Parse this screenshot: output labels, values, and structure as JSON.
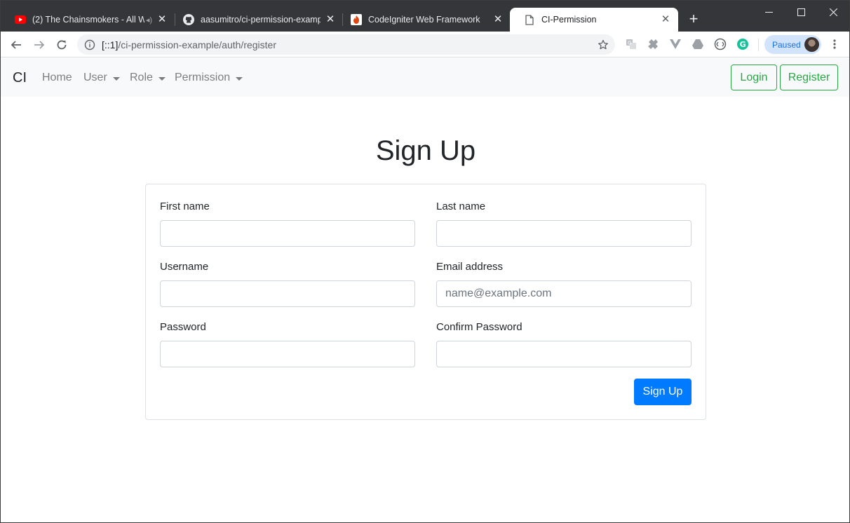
{
  "browser": {
    "tabs": [
      {
        "title": "(2) The Chainsmokers - All W",
        "icon": "youtube-icon",
        "active": false
      },
      {
        "title": "aasumitro/ci-permission-example",
        "icon": "github-icon",
        "active": false
      },
      {
        "title": "CodeIgniter Web Framework",
        "icon": "codeigniter-icon",
        "active": false
      },
      {
        "title": "CI-Permission",
        "icon": "page-icon",
        "active": true
      }
    ],
    "url_host": "[::1]",
    "url_path": "/ci-permission-example/auth/register",
    "profile_status": "Paused"
  },
  "navbar": {
    "brand": "CI",
    "links": {
      "home": "Home",
      "user": "User",
      "role": "Role",
      "permission": "Permission"
    },
    "login_label": "Login",
    "register_label": "Register"
  },
  "form": {
    "heading": "Sign Up",
    "first_name_label": "First name",
    "last_name_label": "Last name",
    "username_label": "Username",
    "email_label": "Email address",
    "email_placeholder": "name@example.com",
    "password_label": "Password",
    "confirm_password_label": "Confirm Password",
    "submit_label": "Sign Up"
  },
  "colors": {
    "brand_green": "#28a745",
    "primary_blue": "#007bff",
    "tabstrip": "#35363a"
  }
}
